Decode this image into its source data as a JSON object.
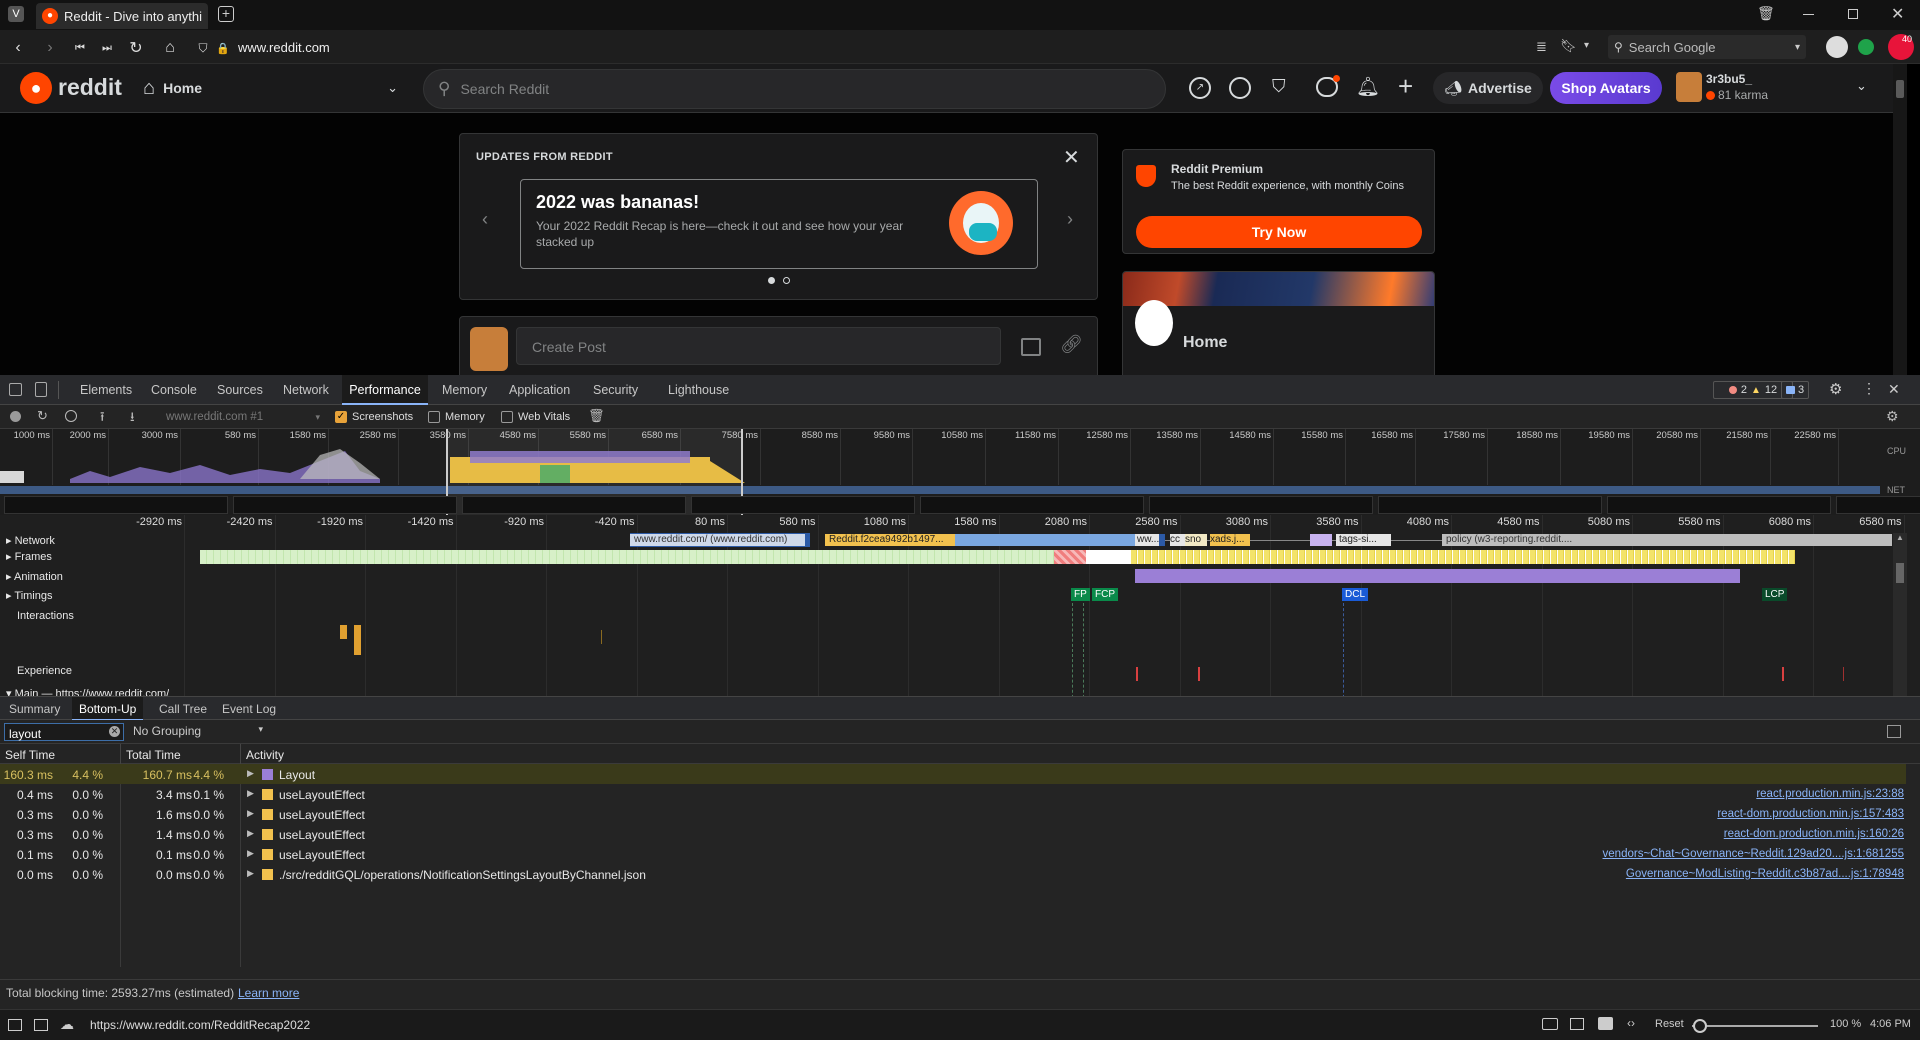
{
  "browser": {
    "tab_title": "Reddit - Dive into anything",
    "url": "www.reddit.com",
    "search_placeholder": "Search Google",
    "notif_count": "40"
  },
  "reddit": {
    "logo_text": "reddit",
    "home_label": "Home",
    "search_placeholder": "Search Reddit",
    "advertise_label": "Advertise",
    "shop_avatars_label": "Shop Avatars",
    "username": "3r3bu5_",
    "karma": "81 karma"
  },
  "updates": {
    "header": "UPDATES FROM REDDIT",
    "title": "2022 was bananas!",
    "body": "Your 2022 Reddit Recap is here—check it out and see how your year stacked up"
  },
  "premium": {
    "title": "Reddit Premium",
    "body": "The best Reddit experience, with monthly Coins",
    "cta": "Try Now"
  },
  "home_card": {
    "title": "Home"
  },
  "create_post": {
    "placeholder": "Create Post"
  },
  "devtools": {
    "tabs": [
      "Elements",
      "Console",
      "Sources",
      "Network",
      "Performance",
      "Memory",
      "Application",
      "Security",
      "Lighthouse"
    ],
    "active_tab": "Performance",
    "errors": "2",
    "warnings": "12",
    "messages": "3",
    "recording_select": "www.reddit.com #1",
    "screenshots_label": "Screenshots",
    "memory_label": "Memory",
    "webvitals_label": "Web Vitals",
    "overview_ticks": [
      "1000 ms",
      "2000 ms",
      "3000 ms",
      "580 ms",
      "1580 ms",
      "2580 ms",
      "3580 ms",
      "4580 ms",
      "5580 ms",
      "6580 ms",
      "7580 ms",
      "8580 ms",
      "9580 ms",
      "10580 ms",
      "11580 ms",
      "12580 ms",
      "13580 ms",
      "14580 ms",
      "15580 ms",
      "16580 ms",
      "17580 ms",
      "18580 ms",
      "19580 ms",
      "20580 ms",
      "21580 ms",
      "22580 ms"
    ],
    "cpu_label": "CPU",
    "net_label": "NET",
    "flame_ticks": [
      "-2920 ms",
      "-2420 ms",
      "-1920 ms",
      "-1420 ms",
      "-920 ms",
      "-420 ms",
      "80 ms",
      "580 ms",
      "1080 ms",
      "1580 ms",
      "2080 ms",
      "2580 ms",
      "3080 ms",
      "3580 ms",
      "4080 ms",
      "4580 ms",
      "5080 ms",
      "5580 ms",
      "6080 ms",
      "6580 ms"
    ],
    "tracks": [
      "Network",
      "Frames",
      "Animation",
      "Timings",
      "Interactions",
      "Experience",
      "Main — https://www.reddit.com/"
    ],
    "net_labels": [
      "www.reddit.com/ (www.reddit.com)",
      "Reddit.f2cea9492b1497...",
      "ww...",
      "cc",
      "sno",
      "xads.j...",
      "tags-si...",
      "policy (w3-reporting.reddit...."
    ],
    "timings": [
      "FP",
      "FCP",
      "DCL",
      "LCP"
    ],
    "bottom_tabs": [
      "Summary",
      "Bottom-Up",
      "Call Tree",
      "Event Log"
    ],
    "active_bottom_tab": "Bottom-Up",
    "filter_value": "layout",
    "grouping": "No Grouping",
    "col_self": "Self Time",
    "col_total": "Total Time",
    "col_activity": "Activity",
    "rows": [
      {
        "self": "160.3 ms",
        "self_pct": "4.4 %",
        "total": "160.7 ms",
        "total_pct": "4.4 %",
        "activity": "Layout",
        "source": ""
      },
      {
        "self": "0.4 ms",
        "self_pct": "0.0 %",
        "total": "3.4 ms",
        "total_pct": "0.1 %",
        "activity": "useLayoutEffect",
        "source": "react.production.min.js:23:88"
      },
      {
        "self": "0.3 ms",
        "self_pct": "0.0 %",
        "total": "1.6 ms",
        "total_pct": "0.0 %",
        "activity": "useLayoutEffect",
        "source": "react-dom.production.min.js:157:483"
      },
      {
        "self": "0.3 ms",
        "self_pct": "0.0 %",
        "total": "1.4 ms",
        "total_pct": "0.0 %",
        "activity": "useLayoutEffect",
        "source": "react-dom.production.min.js:160:26"
      },
      {
        "self": "0.1 ms",
        "self_pct": "0.0 %",
        "total": "0.1 ms",
        "total_pct": "0.0 %",
        "activity": "useLayoutEffect",
        "source": "vendors~Chat~Governance~Reddit.129ad20....js:1:681255"
      },
      {
        "self": "0.0 ms",
        "self_pct": "0.0 %",
        "total": "0.0 ms",
        "total_pct": "0.0 %",
        "activity": "./src/redditGQL/operations/NotificationSettingsLayoutByChannel.json",
        "source": "Governance~ModListing~Reddit.c3b87ad....js:1:78948"
      }
    ],
    "blocking_text": "Total blocking time: 2593.27ms (estimated)",
    "learn_more": "Learn more"
  },
  "status": {
    "url": "https://www.reddit.com/RedditRecap2022",
    "reset": "Reset",
    "zoom": "100 %",
    "time": "4:06 PM"
  }
}
